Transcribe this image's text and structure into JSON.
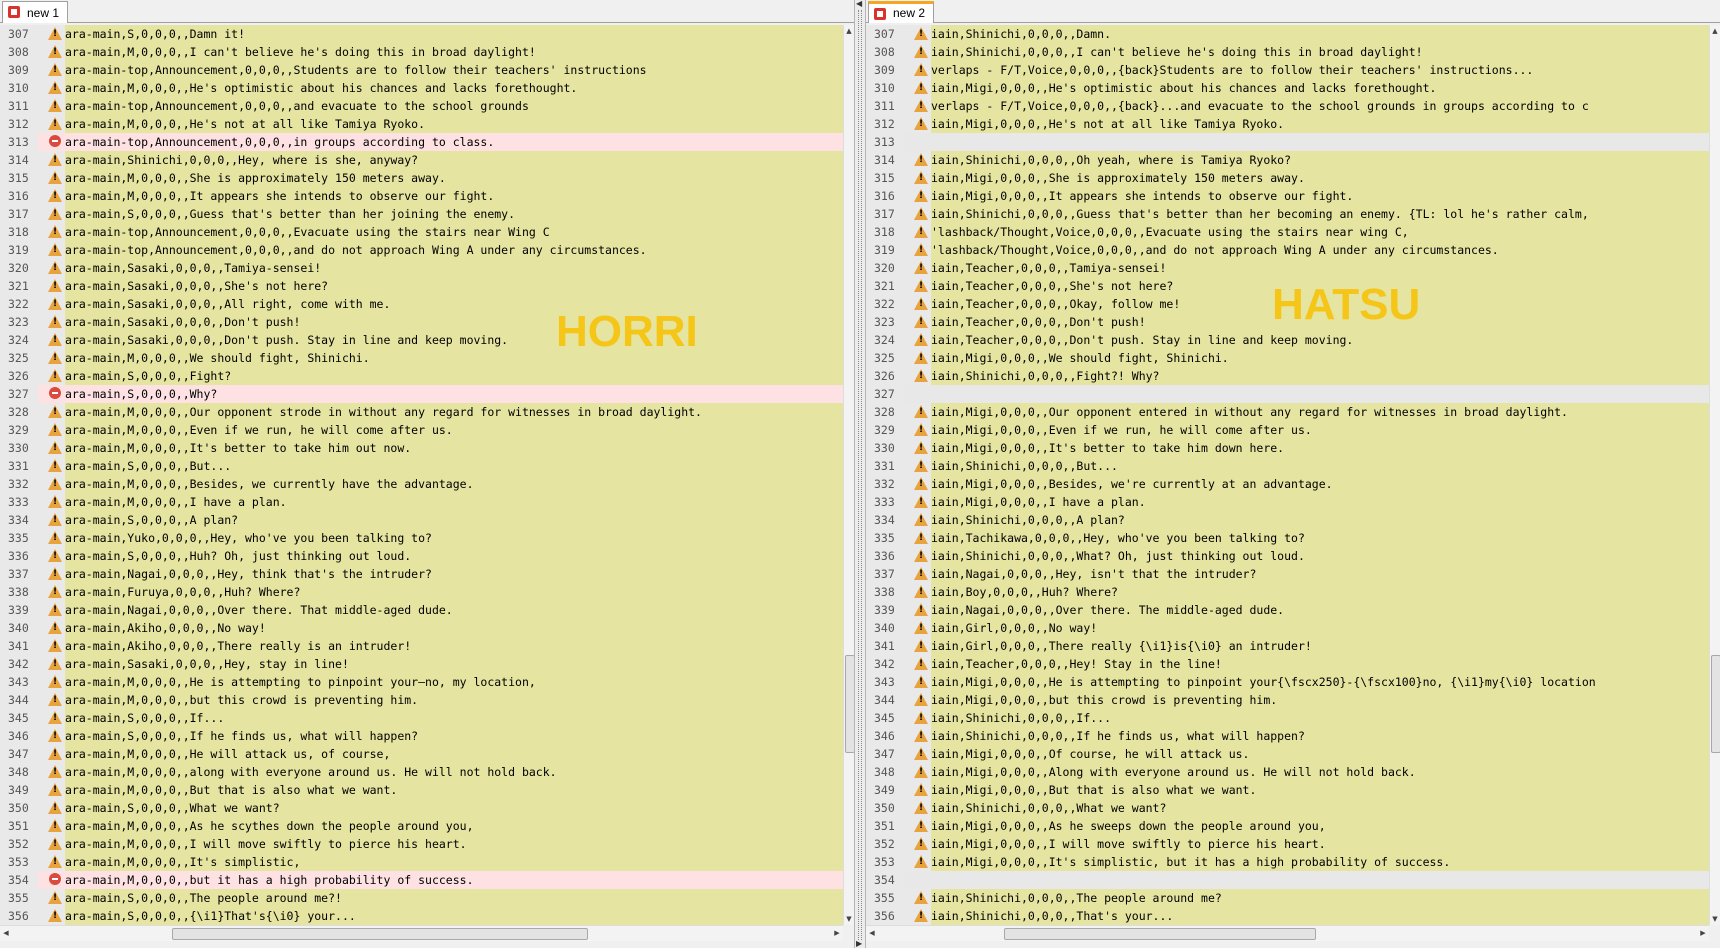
{
  "left": {
    "tab_label": "new 1",
    "watermark": "HORRI",
    "lines": [
      {
        "num": "307",
        "kind": "warn",
        "text": "ara-main,S,0,0,0,,Damn it!"
      },
      {
        "num": "308",
        "kind": "warn",
        "text": "ara-main,M,0,0,0,,I can't believe he's doing this in broad daylight!"
      },
      {
        "num": "309",
        "kind": "warn",
        "text": "ara-main-top,Announcement,0,0,0,,Students are to follow their teachers' instructions"
      },
      {
        "num": "310",
        "kind": "warn",
        "text": "ara-main,M,0,0,0,,He's optimistic about his chances and lacks forethought."
      },
      {
        "num": "311",
        "kind": "warn",
        "text": "ara-main-top,Announcement,0,0,0,,and evacuate to the school grounds"
      },
      {
        "num": "312",
        "kind": "warn",
        "text": "ara-main,M,0,0,0,,He's not at all like Tamiya Ryoko."
      },
      {
        "num": "313",
        "kind": "err",
        "text": "ara-main-top,Announcement,0,0,0,,in groups according to class."
      },
      {
        "num": "314",
        "kind": "warn",
        "text": "ara-main,Shinichi,0,0,0,,Hey, where is she, anyway?"
      },
      {
        "num": "315",
        "kind": "warn",
        "text": "ara-main,M,0,0,0,,She is approximately 150 meters away."
      },
      {
        "num": "316",
        "kind": "warn",
        "text": "ara-main,M,0,0,0,,It appears she intends to observe our fight."
      },
      {
        "num": "317",
        "kind": "warn",
        "text": "ara-main,S,0,0,0,,Guess that's better than her joining the enemy."
      },
      {
        "num": "318",
        "kind": "warn",
        "text": "ara-main-top,Announcement,0,0,0,,Evacuate using the stairs near Wing C"
      },
      {
        "num": "319",
        "kind": "warn",
        "text": "ara-main-top,Announcement,0,0,0,,and do not approach Wing A under any circumstances."
      },
      {
        "num": "320",
        "kind": "warn",
        "text": "ara-main,Sasaki,0,0,0,,Tamiya-sensei!"
      },
      {
        "num": "321",
        "kind": "warn",
        "text": "ara-main,Sasaki,0,0,0,,She's not here?"
      },
      {
        "num": "322",
        "kind": "warn",
        "text": "ara-main,Sasaki,0,0,0,,All right, come with me."
      },
      {
        "num": "323",
        "kind": "warn",
        "text": "ara-main,Sasaki,0,0,0,,Don't push!"
      },
      {
        "num": "324",
        "kind": "warn",
        "text": "ara-main,Sasaki,0,0,0,,Don't push. Stay in line and keep moving."
      },
      {
        "num": "325",
        "kind": "warn",
        "text": "ara-main,M,0,0,0,,We should fight, Shinichi."
      },
      {
        "num": "326",
        "kind": "warn",
        "text": "ara-main,S,0,0,0,,Fight?"
      },
      {
        "num": "327",
        "kind": "err",
        "text": "ara-main,S,0,0,0,,Why?"
      },
      {
        "num": "328",
        "kind": "warn",
        "text": "ara-main,M,0,0,0,,Our opponent strode in without any regard for witnesses in broad daylight."
      },
      {
        "num": "329",
        "kind": "warn",
        "text": "ara-main,M,0,0,0,,Even if we run, he will come after us."
      },
      {
        "num": "330",
        "kind": "warn",
        "text": "ara-main,M,0,0,0,,It's better to take him out now."
      },
      {
        "num": "331",
        "kind": "warn",
        "text": "ara-main,S,0,0,0,,But..."
      },
      {
        "num": "332",
        "kind": "warn",
        "text": "ara-main,M,0,0,0,,Besides, we currently have the advantage."
      },
      {
        "num": "333",
        "kind": "warn",
        "text": "ara-main,M,0,0,0,,I have a plan."
      },
      {
        "num": "334",
        "kind": "warn",
        "text": "ara-main,S,0,0,0,,A plan?"
      },
      {
        "num": "335",
        "kind": "warn",
        "text": "ara-main,Yuko,0,0,0,,Hey, who've you been talking to?"
      },
      {
        "num": "336",
        "kind": "warn",
        "text": "ara-main,S,0,0,0,,Huh? Oh, just thinking out loud."
      },
      {
        "num": "337",
        "kind": "warn",
        "text": "ara-main,Nagai,0,0,0,,Hey, think that's the intruder?"
      },
      {
        "num": "338",
        "kind": "warn",
        "text": "ara-main,Furuya,0,0,0,,Huh? Where?"
      },
      {
        "num": "339",
        "kind": "warn",
        "text": "ara-main,Nagai,0,0,0,,Over there. That middle-aged dude."
      },
      {
        "num": "340",
        "kind": "warn",
        "text": "ara-main,Akiho,0,0,0,,No way!"
      },
      {
        "num": "341",
        "kind": "warn",
        "text": "ara-main,Akiho,0,0,0,,There really is an intruder!"
      },
      {
        "num": "342",
        "kind": "warn",
        "text": "ara-main,Sasaki,0,0,0,,Hey, stay in line!"
      },
      {
        "num": "343",
        "kind": "warn",
        "text": "ara-main,M,0,0,0,,He is attempting to pinpoint your—no, my location,"
      },
      {
        "num": "344",
        "kind": "warn",
        "text": "ara-main,M,0,0,0,,but this crowd is preventing him."
      },
      {
        "num": "345",
        "kind": "warn",
        "text": "ara-main,S,0,0,0,,If..."
      },
      {
        "num": "346",
        "kind": "warn",
        "text": "ara-main,S,0,0,0,,If he finds us, what will happen?"
      },
      {
        "num": "347",
        "kind": "warn",
        "text": "ara-main,M,0,0,0,,He will attack us, of course,"
      },
      {
        "num": "348",
        "kind": "warn",
        "text": "ara-main,M,0,0,0,,along with everyone around us. He will not hold back."
      },
      {
        "num": "349",
        "kind": "warn",
        "text": "ara-main,M,0,0,0,,But that is also what we want."
      },
      {
        "num": "350",
        "kind": "warn",
        "text": "ara-main,S,0,0,0,,What we want?"
      },
      {
        "num": "351",
        "kind": "warn",
        "text": "ara-main,M,0,0,0,,As he scythes down the people around you,"
      },
      {
        "num": "352",
        "kind": "warn",
        "text": "ara-main,M,0,0,0,,I will move swiftly to pierce his heart."
      },
      {
        "num": "353",
        "kind": "warn",
        "text": "ara-main,M,0,0,0,,It's simplistic,"
      },
      {
        "num": "354",
        "kind": "err",
        "text": "ara-main,M,0,0,0,,but it has a high probability of success."
      },
      {
        "num": "355",
        "kind": "warn",
        "text": "ara-main,S,0,0,0,,The people around me?!"
      },
      {
        "num": "356",
        "kind": "warn",
        "text": "ara-main,S,0,0,0,,{\\i1}That's{\\i0} your..."
      }
    ]
  },
  "right": {
    "tab_label": "new 2",
    "watermark": "HATSU",
    "lines": [
      {
        "num": "307",
        "kind": "warn",
        "text": "iain,Shinichi,0,0,0,,Damn."
      },
      {
        "num": "308",
        "kind": "warn",
        "text": "iain,Shinichi,0,0,0,,I can't believe he's doing this in broad daylight!"
      },
      {
        "num": "309",
        "kind": "warn",
        "text": "verlaps - F/T,Voice,0,0,0,,{back}Students are to follow their teachers' instructions..."
      },
      {
        "num": "310",
        "kind": "warn",
        "text": "iain,Migi,0,0,0,,He's optimistic about his chances and lacks forethought."
      },
      {
        "num": "311",
        "kind": "warn",
        "text": "verlaps - F/T,Voice,0,0,0,,{back}...and evacuate to the school grounds in groups according to c"
      },
      {
        "num": "312",
        "kind": "warn",
        "text": "iain,Migi,0,0,0,,He's not at all like Tamiya Ryoko."
      },
      {
        "num": "313",
        "kind": "empty",
        "text": ""
      },
      {
        "num": "314",
        "kind": "warn",
        "text": "iain,Shinichi,0,0,0,,Oh yeah, where is Tamiya Ryoko?"
      },
      {
        "num": "315",
        "kind": "warn",
        "text": "iain,Migi,0,0,0,,She is approximately 150 meters away."
      },
      {
        "num": "316",
        "kind": "warn",
        "text": "iain,Migi,0,0,0,,It appears she intends to observe our fight."
      },
      {
        "num": "317",
        "kind": "warn",
        "text": "iain,Shinichi,0,0,0,,Guess that's better than her becoming an enemy. {TL: lol he's rather calm,"
      },
      {
        "num": "318",
        "kind": "warn",
        "text": "'lashback/Thought,Voice,0,0,0,,Evacuate using the stairs near wing C,"
      },
      {
        "num": "319",
        "kind": "warn",
        "text": "'lashback/Thought,Voice,0,0,0,,and do not approach Wing A under any circumstances."
      },
      {
        "num": "320",
        "kind": "warn",
        "text": "iain,Teacher,0,0,0,,Tamiya-sensei!"
      },
      {
        "num": "321",
        "kind": "warn",
        "text": "iain,Teacher,0,0,0,,She's not here?"
      },
      {
        "num": "322",
        "kind": "warn",
        "text": "iain,Teacher,0,0,0,,Okay, follow me!"
      },
      {
        "num": "323",
        "kind": "warn",
        "text": "iain,Teacher,0,0,0,,Don't push!"
      },
      {
        "num": "324",
        "kind": "warn",
        "text": "iain,Teacher,0,0,0,,Don't push. Stay in line and keep moving."
      },
      {
        "num": "325",
        "kind": "warn",
        "text": "iain,Migi,0,0,0,,We should fight, Shinichi."
      },
      {
        "num": "326",
        "kind": "warn",
        "text": "iain,Shinichi,0,0,0,,Fight?! Why?"
      },
      {
        "num": "327",
        "kind": "empty",
        "text": ""
      },
      {
        "num": "328",
        "kind": "warn",
        "text": "iain,Migi,0,0,0,,Our opponent entered in without any regard for witnesses in broad daylight."
      },
      {
        "num": "329",
        "kind": "warn",
        "text": "iain,Migi,0,0,0,,Even if we run, he will come after us."
      },
      {
        "num": "330",
        "kind": "warn",
        "text": "iain,Migi,0,0,0,,It's better to take him down here."
      },
      {
        "num": "331",
        "kind": "warn",
        "text": "iain,Shinichi,0,0,0,,But..."
      },
      {
        "num": "332",
        "kind": "warn",
        "text": "iain,Migi,0,0,0,,Besides, we're currently at an advantage."
      },
      {
        "num": "333",
        "kind": "warn",
        "text": "iain,Migi,0,0,0,,I have a plan."
      },
      {
        "num": "334",
        "kind": "warn",
        "text": "iain,Shinichi,0,0,0,,A plan?"
      },
      {
        "num": "335",
        "kind": "warn",
        "text": "iain,Tachikawa,0,0,0,,Hey, who've you been talking to?"
      },
      {
        "num": "336",
        "kind": "warn",
        "text": "iain,Shinichi,0,0,0,,What? Oh, just thinking out loud."
      },
      {
        "num": "337",
        "kind": "warn",
        "text": "iain,Nagai,0,0,0,,Hey, isn't that the intruder?"
      },
      {
        "num": "338",
        "kind": "warn",
        "text": "iain,Boy,0,0,0,,Huh? Where?"
      },
      {
        "num": "339",
        "kind": "warn",
        "text": "iain,Nagai,0,0,0,,Over there. The middle-aged dude."
      },
      {
        "num": "340",
        "kind": "warn",
        "text": "iain,Girl,0,0,0,,No way!"
      },
      {
        "num": "341",
        "kind": "warn",
        "text": "iain,Girl,0,0,0,,There really {\\i1}is{\\i0} an intruder!"
      },
      {
        "num": "342",
        "kind": "warn",
        "text": "iain,Teacher,0,0,0,,Hey! Stay in the line!"
      },
      {
        "num": "343",
        "kind": "warn",
        "text": "iain,Migi,0,0,0,,He is attempting to pinpoint your{\\fscx250}-{\\fscx100}no, {\\i1}my{\\i0} location"
      },
      {
        "num": "344",
        "kind": "warn",
        "text": "iain,Migi,0,0,0,,but this crowd is preventing him."
      },
      {
        "num": "345",
        "kind": "warn",
        "text": "iain,Shinichi,0,0,0,,If..."
      },
      {
        "num": "346",
        "kind": "warn",
        "text": "iain,Shinichi,0,0,0,,If he finds us, what will happen?"
      },
      {
        "num": "347",
        "kind": "warn",
        "text": "iain,Migi,0,0,0,,Of course, he will attack us."
      },
      {
        "num": "348",
        "kind": "warn",
        "text": "iain,Migi,0,0,0,,Along with everyone around us. He will not hold back."
      },
      {
        "num": "349",
        "kind": "warn",
        "text": "iain,Migi,0,0,0,,But that is also what we want."
      },
      {
        "num": "350",
        "kind": "warn",
        "text": "iain,Shinichi,0,0,0,,What we want?"
      },
      {
        "num": "351",
        "kind": "warn",
        "text": "iain,Migi,0,0,0,,As he sweeps down the people around you,"
      },
      {
        "num": "352",
        "kind": "warn",
        "text": "iain,Migi,0,0,0,,I will move swiftly to pierce his heart."
      },
      {
        "num": "353",
        "kind": "warn",
        "text": "iain,Migi,0,0,0,,It's simplistic, but it has a high probability of success."
      },
      {
        "num": "354",
        "kind": "empty",
        "text": ""
      },
      {
        "num": "355",
        "kind": "warn",
        "text": "iain,Shinichi,0,0,0,,The people around me?"
      },
      {
        "num": "356",
        "kind": "warn",
        "text": "iain,Shinichi,0,0,0,,That's your..."
      }
    ]
  },
  "colors": {
    "line_bg": "#e5e4a1",
    "diff_error_bg": "#fde1e3",
    "empty_line_bg": "#e8e8e8",
    "watermark": "#f5c518",
    "active_tab_accent": "#f5a623"
  },
  "icons": {
    "tab": "notepad-file-icon",
    "warning_marker": "warning-triangle-icon",
    "error_marker": "minus-circle-icon"
  }
}
